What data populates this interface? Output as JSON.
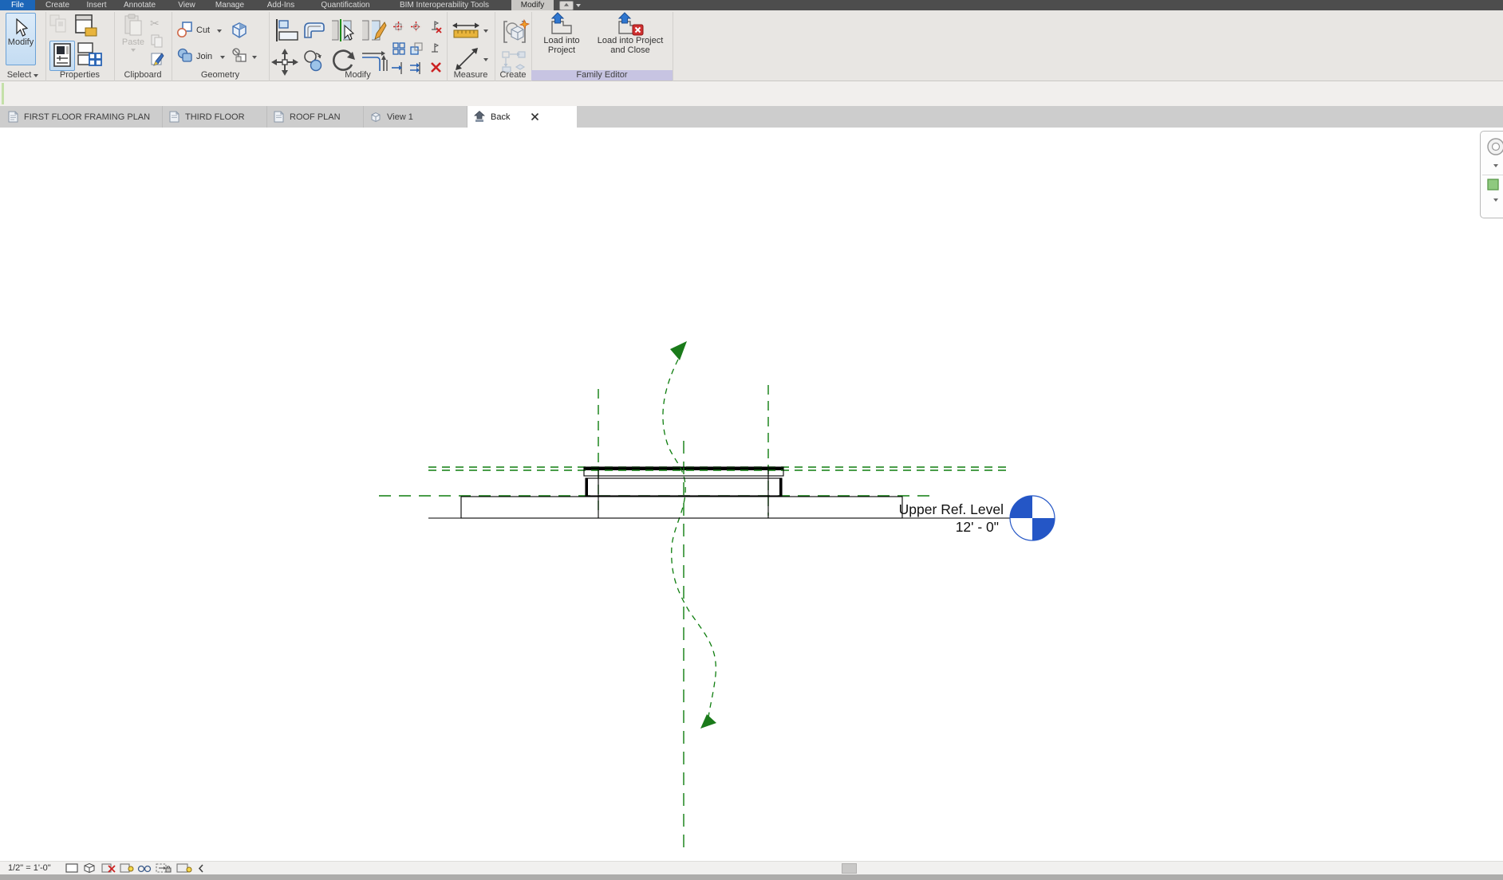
{
  "menubar": {
    "items": [
      {
        "label": "File"
      },
      {
        "label": "Create"
      },
      {
        "label": "Insert"
      },
      {
        "label": "Annotate"
      },
      {
        "label": "View"
      },
      {
        "label": "Manage"
      },
      {
        "label": "Add-Ins"
      },
      {
        "label": "Quantification"
      },
      {
        "label": "BIM Interoperability Tools"
      },
      {
        "label": "Modify"
      }
    ]
  },
  "ribbon": {
    "panels": [
      {
        "label": "Select"
      },
      {
        "label": "Properties"
      },
      {
        "label": "Clipboard"
      },
      {
        "label": "Geometry"
      },
      {
        "label": "Modify"
      },
      {
        "label": "Measure"
      },
      {
        "label": "Create"
      },
      {
        "label": "Family Editor"
      }
    ],
    "select": {
      "modify_button_label": "Modify"
    },
    "clipboard": {
      "paste_label": "Paste"
    },
    "geometry": {
      "cut_label": "Cut",
      "join_label": "Join"
    },
    "family_editor": {
      "load_project_label": "Load into Project",
      "load_close_label": "Load into Project and Close"
    }
  },
  "view_tabs": {
    "tabs": [
      {
        "label": "FIRST FLOOR FRAMING PLAN",
        "icon": "plan-view-icon"
      },
      {
        "label": "THIRD FLOOR",
        "icon": "plan-view-icon"
      },
      {
        "label": "ROOF PLAN",
        "icon": "plan-view-icon"
      },
      {
        "label": "View 1",
        "icon": "3d-view-icon"
      },
      {
        "label": "Back",
        "icon": "elevation-view-icon",
        "active": true
      }
    ]
  },
  "canvas": {
    "level": {
      "name": "Upper Ref. Level",
      "elevation": "12' - 0\""
    }
  },
  "status_bar": {
    "scale": "1/2\" = 1'-0\""
  },
  "colors": {
    "ref_plane_green": "#0e7d0e",
    "level_head_blue": "#2456c6",
    "file_tab_blue": "#1c66b8",
    "family_editor_highlight": "#c7c4e2"
  }
}
